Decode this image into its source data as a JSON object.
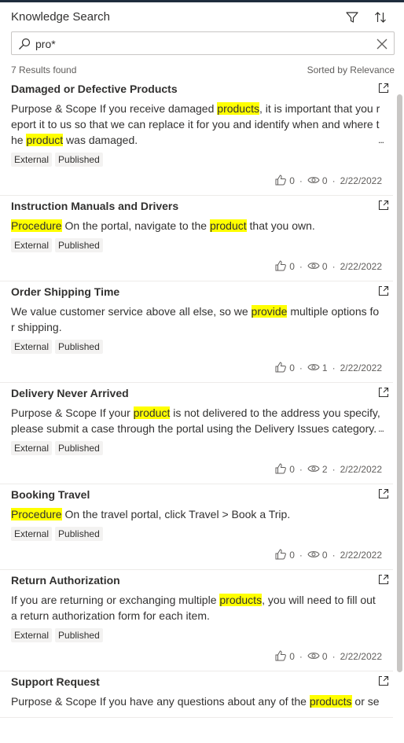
{
  "header": {
    "title": "Knowledge Search"
  },
  "search": {
    "value": "pro*"
  },
  "results": {
    "count_text": "7 Results found",
    "sort_text": "Sorted by Relevance"
  },
  "articles": [
    {
      "title": "Damaged or Defective Products",
      "body": [
        [
          "Purpose & Scope If you receive damaged ",
          false
        ],
        [
          "products",
          true
        ],
        [
          ", it is important that you report it to us so that we can replace it for you and identify when and where the ",
          false
        ],
        [
          "product",
          true
        ],
        [
          " was damaged.",
          false
        ]
      ],
      "truncated": true,
      "tags": [
        "External",
        "Published"
      ],
      "likes": "0",
      "views": "0",
      "date": "2/22/2022"
    },
    {
      "title": "Instruction Manuals and Drivers",
      "body": [
        [
          "Procedure",
          true
        ],
        [
          " On the portal, navigate to the ",
          false
        ],
        [
          "product",
          true
        ],
        [
          " that you own.",
          false
        ]
      ],
      "truncated": false,
      "tags": [
        "External",
        "Published"
      ],
      "likes": "0",
      "views": "0",
      "date": "2/22/2022"
    },
    {
      "title": "Order Shipping Time",
      "body": [
        [
          "We value customer service above all else, so we ",
          false
        ],
        [
          "provide",
          true
        ],
        [
          " multiple options for shipping.",
          false
        ]
      ],
      "truncated": false,
      "tags": [
        "External",
        "Published"
      ],
      "likes": "0",
      "views": "1",
      "date": "2/22/2022"
    },
    {
      "title": "Delivery Never Arrived",
      "body": [
        [
          "Purpose & Scope If your ",
          false
        ],
        [
          "product",
          true
        ],
        [
          " is not delivered to the address you specify, please submit a case through the portal using the Delivery Issues category.",
          false
        ]
      ],
      "truncated": true,
      "tags": [
        "External",
        "Published"
      ],
      "likes": "0",
      "views": "2",
      "date": "2/22/2022"
    },
    {
      "title": "Booking Travel",
      "body": [
        [
          "Procedure",
          true
        ],
        [
          " On the travel portal, click Travel > Book a Trip.",
          false
        ]
      ],
      "truncated": false,
      "tags": [
        "External",
        "Published"
      ],
      "likes": "0",
      "views": "0",
      "date": "2/22/2022"
    },
    {
      "title": "Return Authorization",
      "body": [
        [
          "If you are returning or exchanging multiple ",
          false
        ],
        [
          "products",
          true
        ],
        [
          ", you will need to fill out a return authorization form for each item.",
          false
        ]
      ],
      "truncated": false,
      "tags": [
        "External",
        "Published"
      ],
      "likes": "0",
      "views": "0",
      "date": "2/22/2022"
    },
    {
      "title": "Support Request",
      "body": [
        [
          "Purpose & Scope If you have any questions about any of the ",
          false
        ],
        [
          "products",
          true
        ],
        [
          " or se",
          false
        ]
      ],
      "truncated": false,
      "tags": [],
      "likes": "",
      "views": "",
      "date": ""
    }
  ],
  "ui": {
    "more_glyph": "...",
    "separator": "·"
  },
  "icons": {
    "filter": "filter-icon",
    "sort": "sort-icon",
    "search": "search-icon",
    "clear": "close-icon",
    "open": "open-in-new-window-icon",
    "like": "thumbs-up-icon",
    "view": "eye-icon"
  },
  "colors": {
    "highlight": "#ffff00",
    "tag_bg": "#f3f2f1",
    "top_bar": "#1f2d3d"
  }
}
